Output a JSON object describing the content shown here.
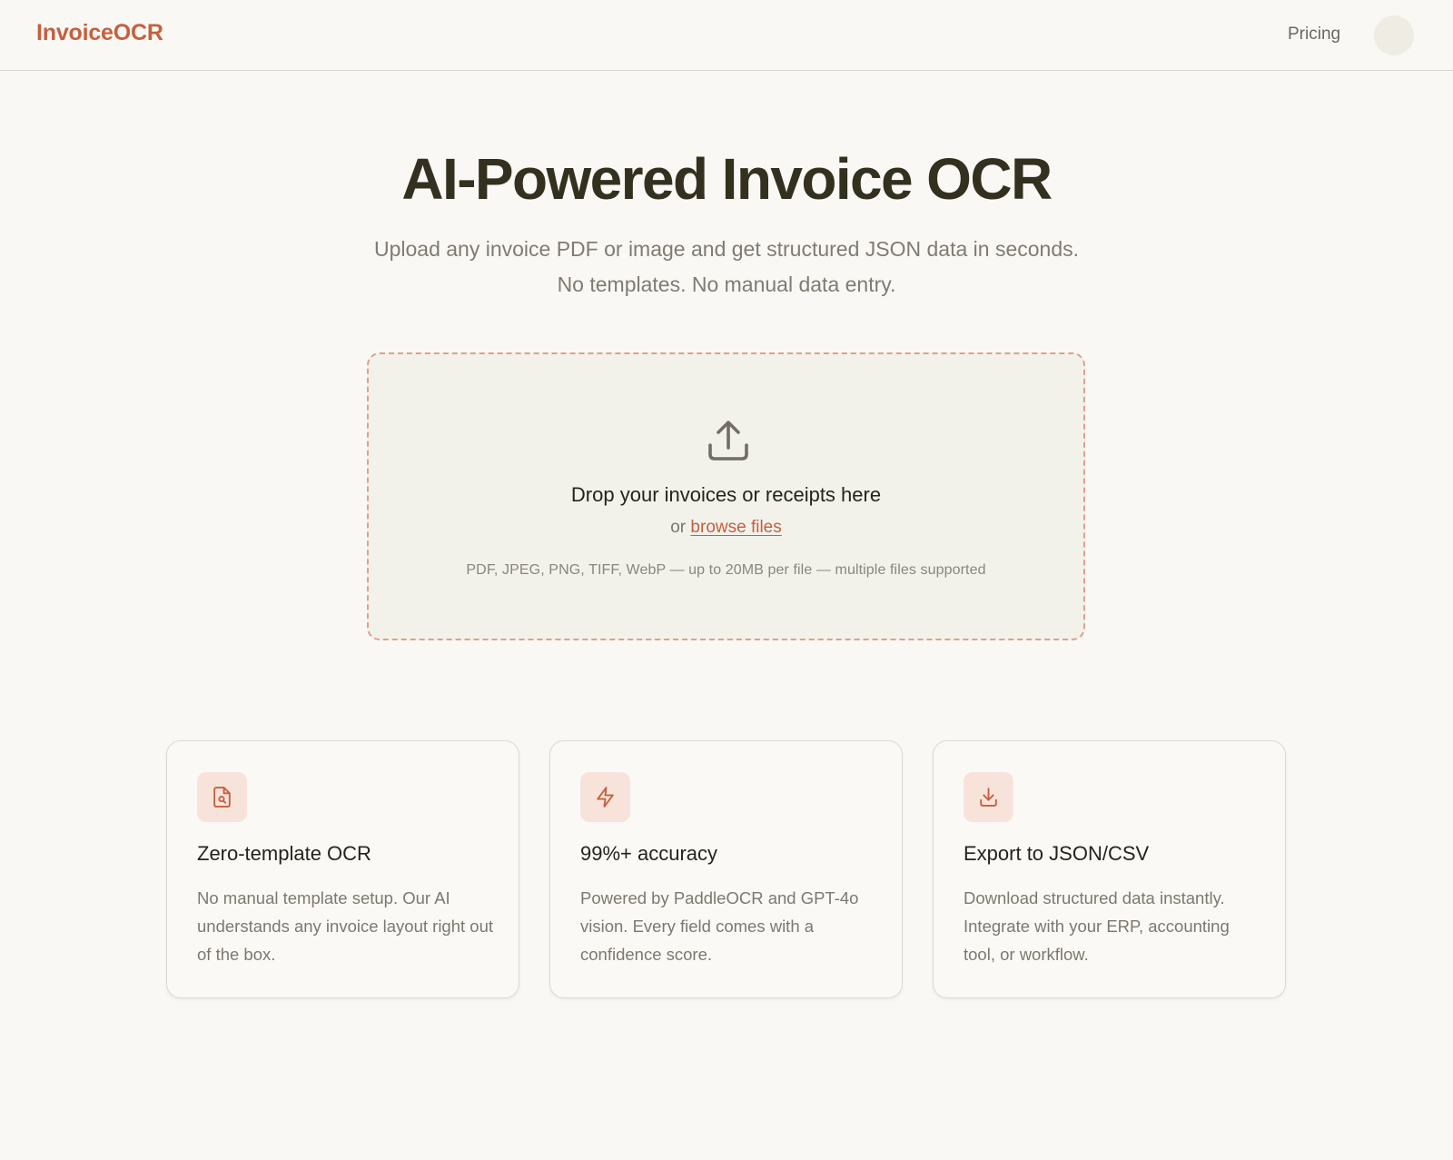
{
  "header": {
    "logo": "InvoiceOCR",
    "nav_pricing": "Pricing"
  },
  "hero": {
    "title": "AI-Powered Invoice OCR",
    "subtitle": "Upload any invoice PDF or image and get structured JSON data in seconds. No templates. No manual data entry."
  },
  "upload": {
    "icon": "upload-icon",
    "title": "Drop your invoices or receipts here",
    "or_text": "or",
    "browse_label": "browse files",
    "formats": "PDF, JPEG, PNG, TIFF, WebP — up to 20MB per file — multiple files supported"
  },
  "features": [
    {
      "icon": "file-search-icon",
      "title": "Zero-template OCR",
      "description": "No manual template setup. Our AI understands any invoice layout right out of the box."
    },
    {
      "icon": "lightning-icon",
      "title": "99%+ accuracy",
      "description": "Powered by PaddleOCR and GPT-4o vision. Every field comes with a confidence score."
    },
    {
      "icon": "download-icon",
      "title": "Export to JSON/CSV",
      "description": "Download structured data instantly. Integrate with your ERP, accounting tool, or workflow."
    }
  ],
  "colors": {
    "accent": "#c5603f",
    "background": "#faf8f5",
    "dropzone_bg": "#f2f1ea",
    "dropzone_border": "#e0a08a",
    "icon_tile_bg": "#f8e3da"
  }
}
